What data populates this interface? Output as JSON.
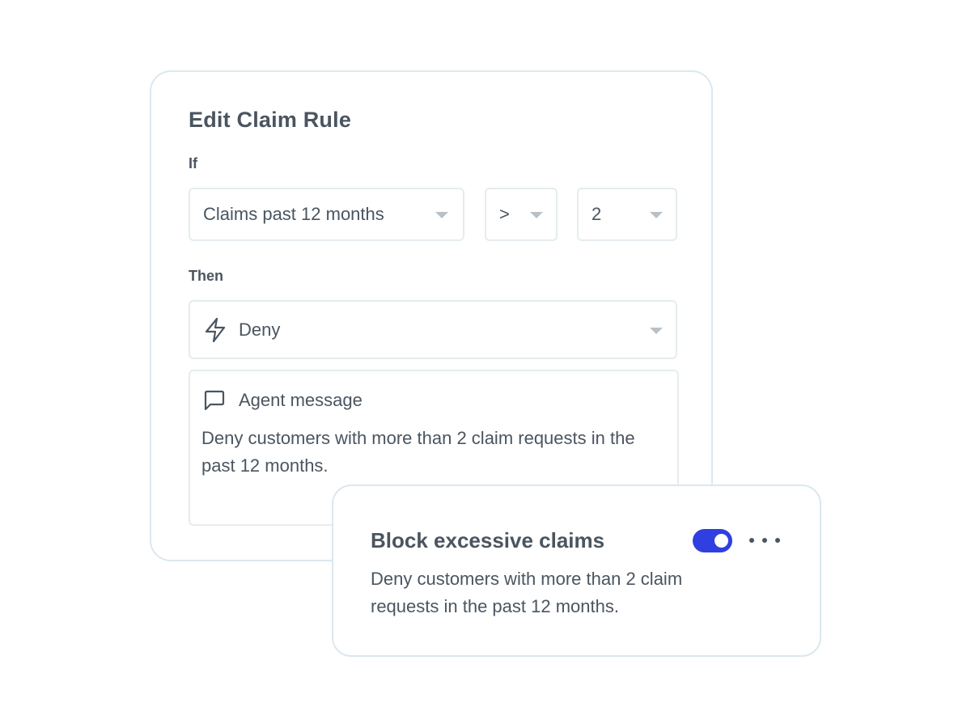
{
  "rule_editor": {
    "title": "Edit Claim Rule",
    "if_label": "If",
    "condition": {
      "metric": "Claims past 12 months",
      "operator": ">",
      "value": "2"
    },
    "then_label": "Then",
    "action": {
      "icon": "lightning-icon",
      "label": "Deny"
    },
    "agent_message": {
      "icon": "message-square-icon",
      "label": "Agent message",
      "text": "Deny customers with more than 2 claim requests in the past 12 months."
    }
  },
  "rule_summary": {
    "title": "Block excessive claims",
    "description": "Deny customers with more than 2 claim requests in the past 12 months.",
    "enabled": true,
    "toggle_color": "#2f3fe0",
    "more_icon": "more-horizontal-icon"
  },
  "colors": {
    "text": "#4a5560",
    "card_border": "#dbe8ee",
    "field_border": "#e5ecef",
    "caret": "#b9c1c7",
    "accent": "#2f3fe0"
  }
}
